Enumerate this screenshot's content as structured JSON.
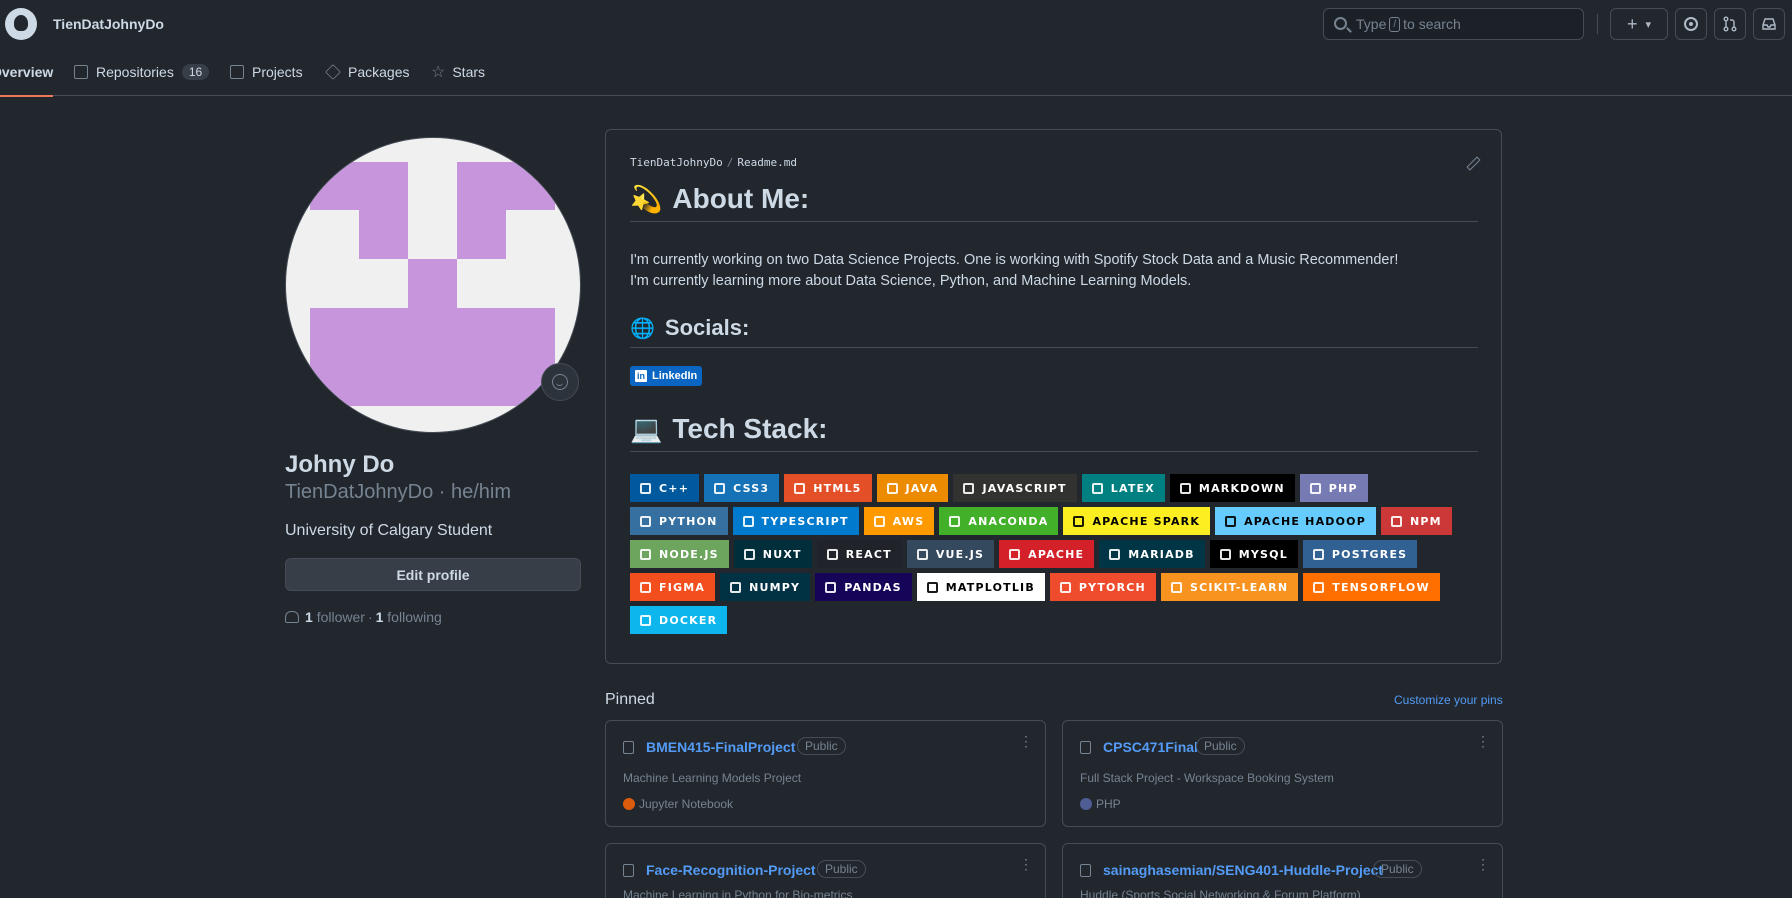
{
  "header": {
    "username": "TienDatJohnyDo",
    "search_prefix": "Type",
    "search_key": "/",
    "search_suffix": "to search",
    "plus": "+",
    "caret": "▾"
  },
  "tabs": [
    {
      "label": "Overview"
    },
    {
      "label": "Repositories",
      "count": "16"
    },
    {
      "label": "Projects"
    },
    {
      "label": "Packages"
    },
    {
      "label": "Stars"
    }
  ],
  "profile": {
    "name": "Johny Do",
    "handle": "TienDatJohnyDo · he/him",
    "bio": "University of Calgary Student",
    "edit_label": "Edit profile",
    "followers_count": "1",
    "followers_label": "follower",
    "sep": "·",
    "following_count": "1",
    "following_label": "following",
    "avatar_color": "#c795dc"
  },
  "readme": {
    "owner": "TienDatJohnyDo",
    "sep": "/",
    "file": "Readme.md",
    "about_title": "About Me:",
    "about_icon": "💫",
    "about_line1": "I'm currently working on two Data Science Projects. One is working with Spotify Stock Data and a Music Recommender!",
    "about_line2": "I'm currently learning more about Data Science, Python, and Machine Learning Models.",
    "socials_title": "Socials:",
    "socials_icon": "🌐",
    "linkedin_label": "LinkedIn",
    "linkedin_icon": "in",
    "tech_title": "Tech Stack:",
    "tech_icon": "💻",
    "badges": [
      [
        {
          "label": "C++",
          "color": "#00599c"
        },
        {
          "label": "CSS3",
          "color": "#1572b6"
        },
        {
          "label": "HTML5",
          "color": "#e34f26"
        },
        {
          "label": "JAVA",
          "color": "#ed8b00"
        },
        {
          "label": "JAVASCRIPT",
          "color": "#323330"
        },
        {
          "label": "LATEX",
          "color": "#008080"
        },
        {
          "label": "MARKDOWN",
          "color": "#000000"
        },
        {
          "label": "PHP",
          "color": "#777bb4"
        }
      ],
      [
        {
          "label": "PYTHON",
          "color": "#3670a0"
        },
        {
          "label": "TYPESCRIPT",
          "color": "#007acc"
        },
        {
          "label": "AWS",
          "color": "#ff9900"
        },
        {
          "label": "ANACONDA",
          "color": "#43b02a"
        },
        {
          "label": "APACHE SPARK",
          "color": "#fdee21",
          "text": "#000000"
        },
        {
          "label": "APACHE HADOOP",
          "color": "#66ccff",
          "text": "#000000"
        },
        {
          "label": "NPM",
          "color": "#cb3837"
        }
      ],
      [
        {
          "label": "NODE.JS",
          "color": "#6da55f"
        },
        {
          "label": "NUXT",
          "color": "#002e3b"
        },
        {
          "label": "REACT",
          "color": "#20232a"
        },
        {
          "label": "VUE.JS",
          "color": "#35495e"
        },
        {
          "label": "APACHE",
          "color": "#d42029"
        },
        {
          "label": "MARIADB",
          "color": "#003545"
        },
        {
          "label": "MYSQL",
          "color": "#000000"
        },
        {
          "label": "POSTGRES",
          "color": "#316192"
        }
      ],
      [
        {
          "label": "FIGMA",
          "color": "#f24e1e"
        },
        {
          "label": "NUMPY",
          "color": "#013243"
        },
        {
          "label": "PANDAS",
          "color": "#150458"
        },
        {
          "label": "MATPLOTLIB",
          "color": "#ffffff",
          "text": "#000000"
        },
        {
          "label": "PYTORCH",
          "color": "#ee4c2c"
        },
        {
          "label": "SCIKIT-LEARN",
          "color": "#f7931e"
        },
        {
          "label": "TENSORFLOW",
          "color": "#ff6f00"
        }
      ],
      [
        {
          "label": "DOCKER",
          "color": "#0db7ed"
        }
      ]
    ]
  },
  "pinned": {
    "title": "Pinned",
    "customize": "Customize your pins",
    "kebab": "⋮",
    "repos": [
      {
        "name": "BMEN415-FinalProject",
        "visibility": "Public",
        "desc": "Machine Learning Models Project",
        "lang": "Jupyter Notebook",
        "lang_color": "#da5b0b"
      },
      {
        "name": "CPSC471Final",
        "visibility": "Public",
        "desc": "Full Stack Project - Workspace Booking System",
        "lang": "PHP",
        "lang_color": "#4f5d95"
      },
      {
        "name": "Face-Recognition-Project",
        "visibility": "Public",
        "desc": "Machine Learning in Python for Bio-metrics",
        "lang": "",
        "lang_color": ""
      },
      {
        "name": "sainaghasemian/SENG401-Huddle-Project",
        "visibility": "Public",
        "desc": "Huddle (Sports Social Networking & Forum Platform)",
        "lang": "",
        "lang_color": ""
      }
    ]
  }
}
